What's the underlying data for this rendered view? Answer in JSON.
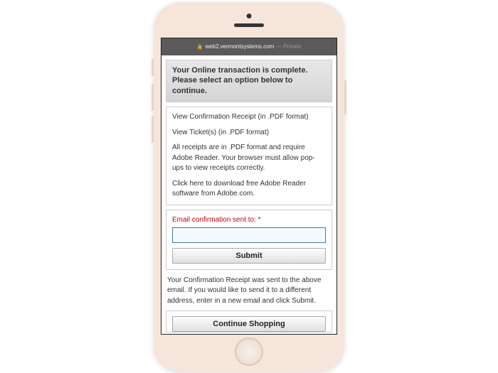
{
  "browser": {
    "url": "web2.vermontsystems.com",
    "mode": "— Private"
  },
  "header": {
    "text": "Your Online transaction is complete. Please select an option below to continue."
  },
  "info": {
    "line1": "View Confirmation Receipt (in .PDF format)",
    "line2": "View Ticket(s) (in .PDF format)",
    "line3": "All receipts are in .PDF format and require Adobe Reader. Your browser must allow pop-ups to view receipts correctly.",
    "line4": "Click here to download free Adobe Reader software from Adobe.com."
  },
  "email": {
    "label": "Email confirmation sent to: *",
    "value": "",
    "submit": "Submit",
    "followup": "Your Confirmation Receipt was sent to the above email. If you would like to send it to a different address, enter in a new email and click Submit."
  },
  "continue": {
    "label": "Continue Shopping"
  }
}
